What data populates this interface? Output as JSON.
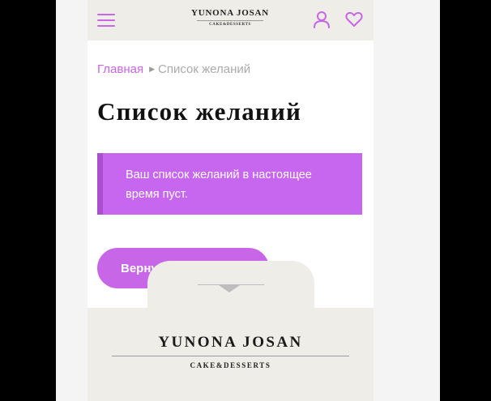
{
  "header": {
    "logo_top": "YUNONA JOSAN",
    "logo_bottom": "CAKE&DESSERTS"
  },
  "icons": {
    "menu": "hamburger-menu-icon",
    "account": "user-icon",
    "wishlist": "heart-icon",
    "toggle": "chevron-down-icon"
  },
  "breadcrumb": {
    "home": "Главная",
    "current": "Список желаний"
  },
  "page": {
    "title": "Список желаний",
    "notice": "Ваш список желаний в настоящее время пуст.",
    "return_button": "Вернуться в магазин"
  },
  "footer": {
    "logo_top": "YUNONA JOSAN",
    "logo_bottom": "CAKE&DESSERTS"
  },
  "colors": {
    "accent": "#c766e6",
    "notice_bg": "#c766ee",
    "notice_border": "#a94fcf",
    "header_bg": "#efede8",
    "title": "#111111"
  }
}
